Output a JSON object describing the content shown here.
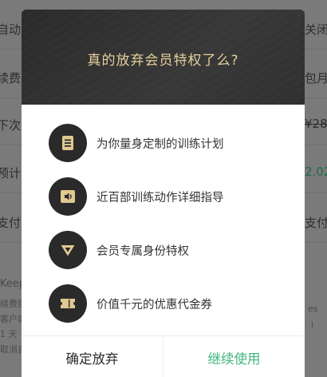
{
  "background": {
    "rows": [
      {
        "left": "自动",
        "right": "关闭"
      },
      {
        "left": "续费",
        "right": "包月"
      },
      {
        "left": "下次",
        "right": "¥28"
      },
      {
        "left": "预计",
        "right": "2.02"
      },
      {
        "left": "支付",
        "right": "支付"
      }
    ],
    "footer_left": [
      "Keep",
      "续费提",
      "客户端",
      "1 天",
      "取消自"
    ],
    "footer_right": [
      "es",
      "i"
    ]
  },
  "modal": {
    "title": "真的放弃会员特权了么?",
    "perks": [
      {
        "icon": "document-icon",
        "label": "为你量身定制的训练计划"
      },
      {
        "icon": "speaker-icon",
        "label": "近百部训练动作详细指导"
      },
      {
        "icon": "vip-badge-icon",
        "label": "会员专属身份特权"
      },
      {
        "icon": "coupon-icon",
        "label": "价值千元的优惠代金券"
      }
    ],
    "confirm_label": "确定放弃",
    "continue_label": "继续使用"
  },
  "colors": {
    "header_bg": "#2e2e2e",
    "title_gold": "#e5cf9d",
    "icon_gold": "#e0c891",
    "continue_green": "#3fb57c"
  }
}
